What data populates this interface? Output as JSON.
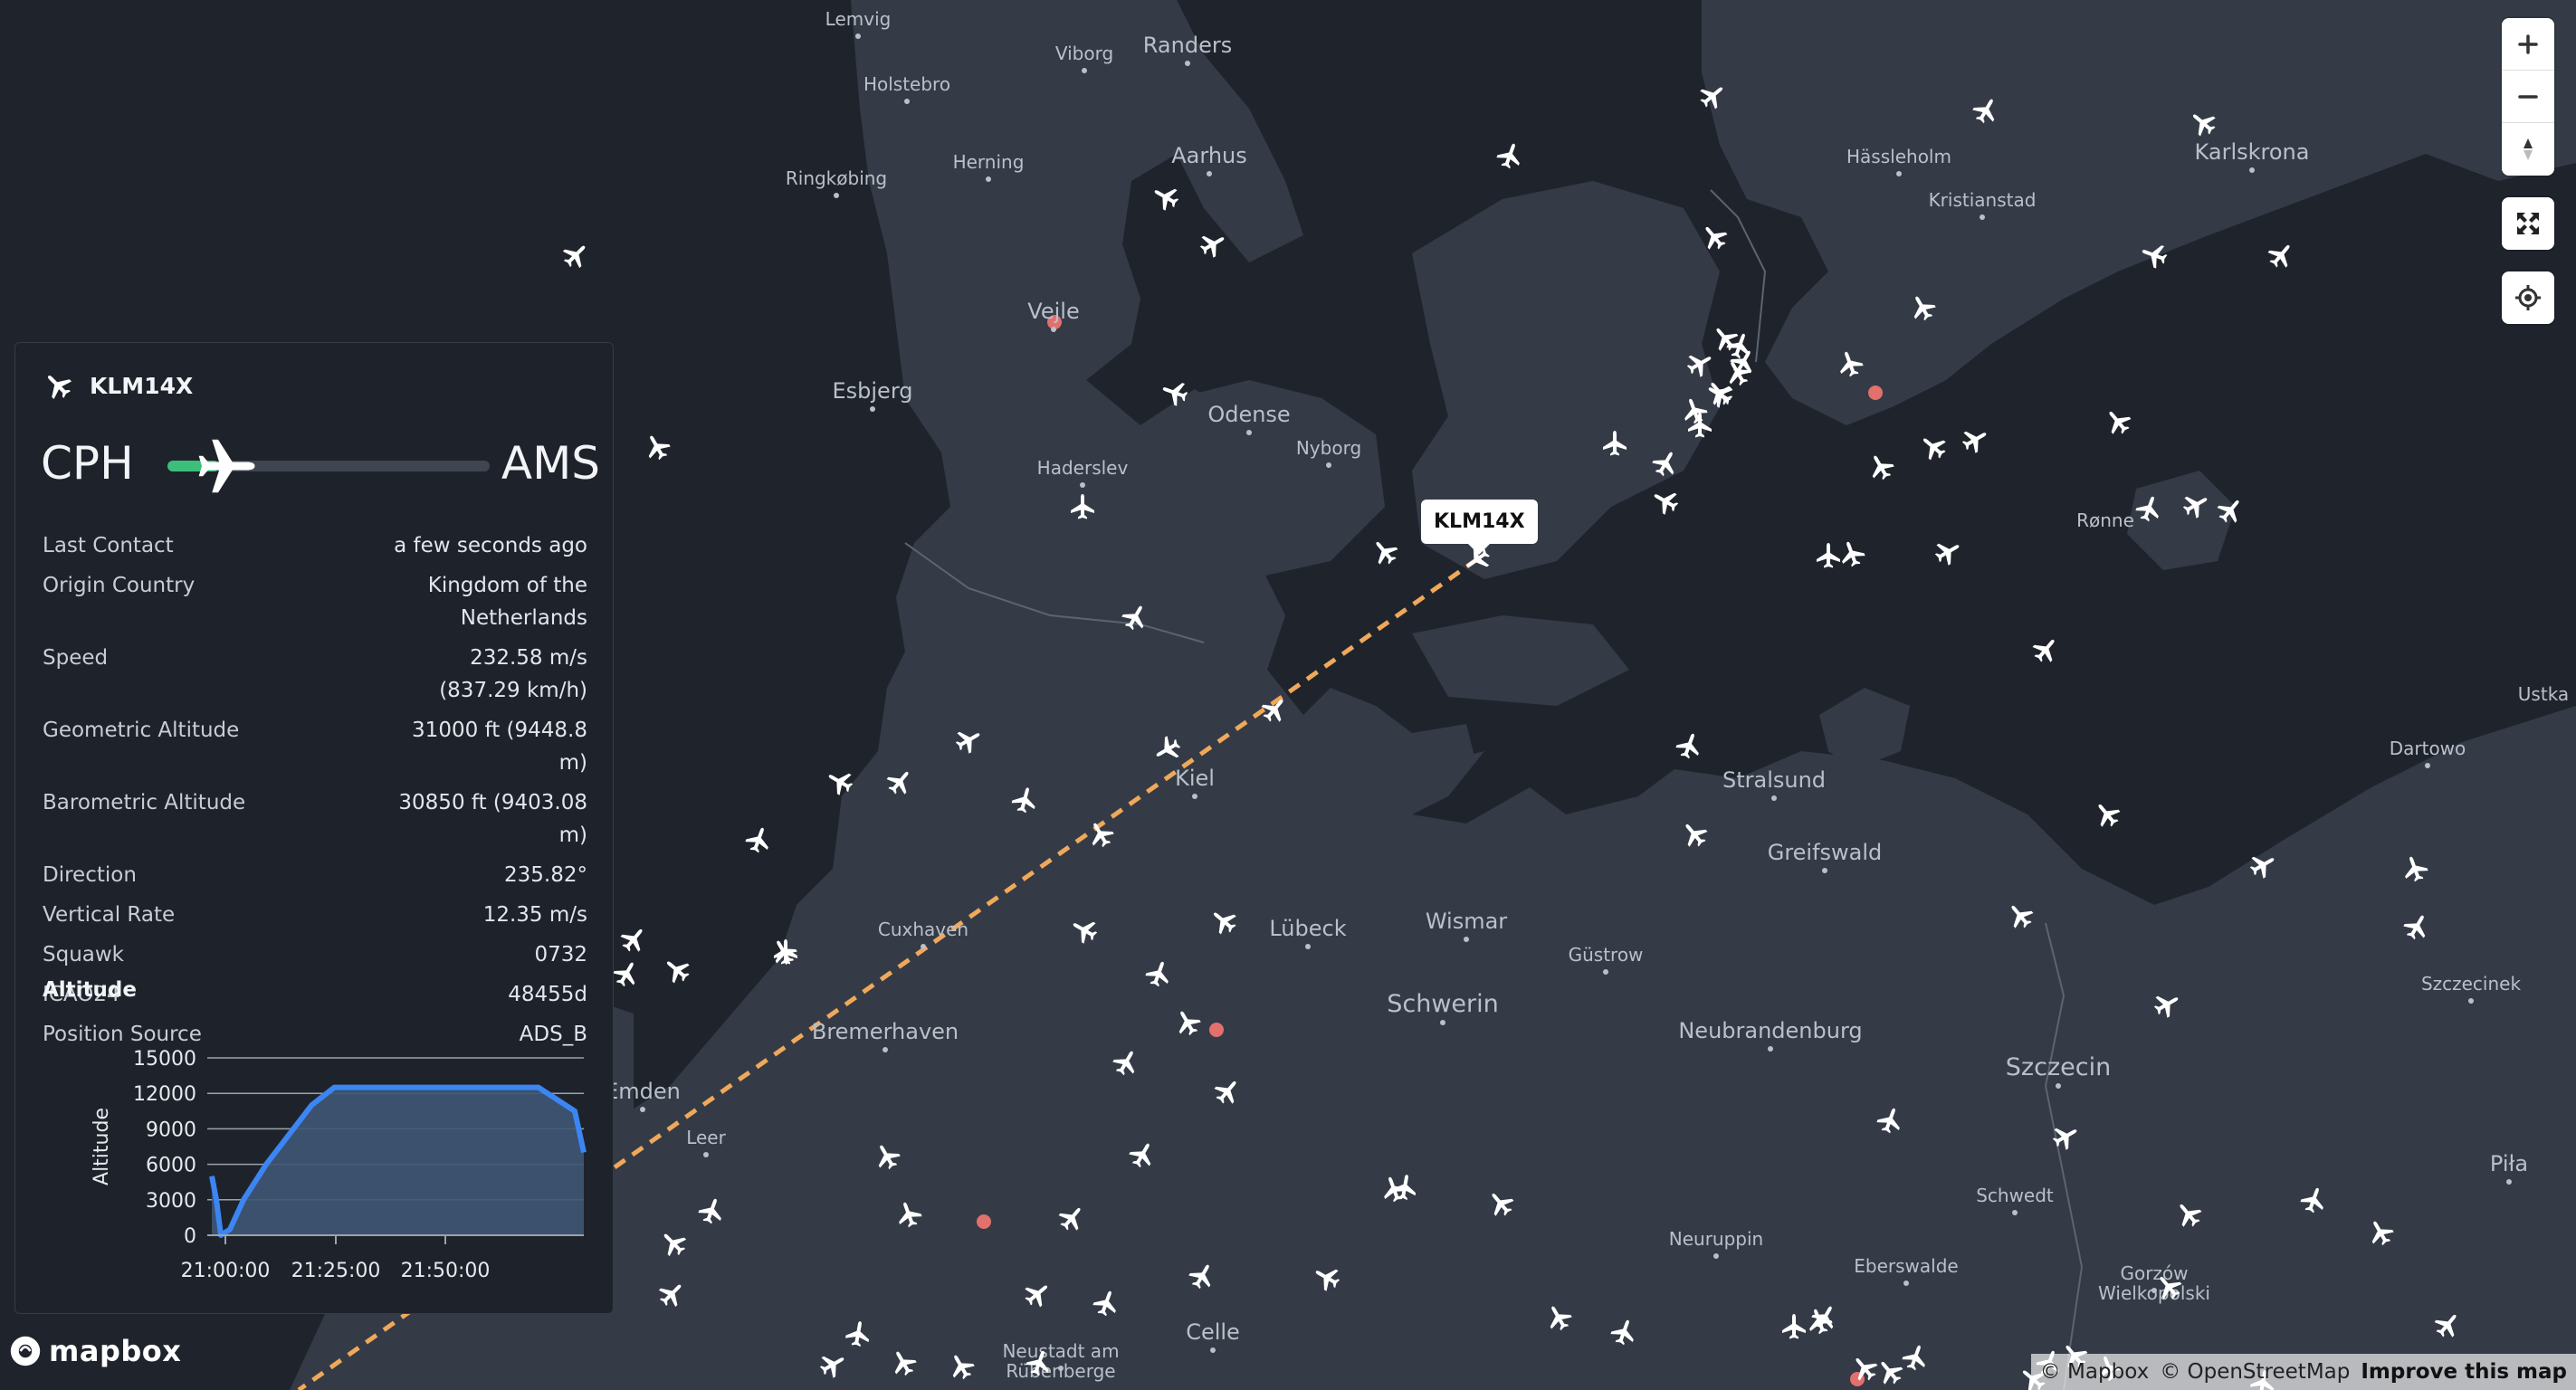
{
  "map": {
    "colors": {
      "land": "#343b46",
      "water": "#1f242c",
      "border": "#5b6470",
      "city_text": "#b9c0c9",
      "flight_path": "#f0a85a",
      "poi": "#e2706c"
    },
    "cities": [
      {
        "name": "Lemvig",
        "size": "s"
      },
      {
        "name": "Viborg",
        "size": "s"
      },
      {
        "name": "Randers",
        "size": "m"
      },
      {
        "name": "Holstebro",
        "size": "s"
      },
      {
        "name": "Herning",
        "size": "s"
      },
      {
        "name": "Aarhus",
        "size": "m"
      },
      {
        "name": "Ringkøbing",
        "size": "s"
      },
      {
        "name": "Vejle",
        "size": "m"
      },
      {
        "name": "Esbjerg",
        "size": "m"
      },
      {
        "name": "Odense",
        "size": "m"
      },
      {
        "name": "Nyborg",
        "size": "s"
      },
      {
        "name": "Haderslev",
        "size": "s"
      },
      {
        "name": "Kiel",
        "size": "m"
      },
      {
        "name": "Cuxhaven",
        "size": "s"
      },
      {
        "name": "Lübeck",
        "size": "m"
      },
      {
        "name": "Wismar",
        "size": "m"
      },
      {
        "name": "Bremerhaven",
        "size": "m"
      },
      {
        "name": "Schwerin",
        "size": "l"
      },
      {
        "name": "Güstrow",
        "size": "s"
      },
      {
        "name": "Emden",
        "size": "m"
      },
      {
        "name": "Leer",
        "size": "s"
      },
      {
        "name": "Stralsund",
        "size": "m"
      },
      {
        "name": "Greifswald",
        "size": "m"
      },
      {
        "name": "Neubrandenburg",
        "size": "m"
      },
      {
        "name": "Szczecin",
        "size": "l"
      },
      {
        "name": "Schwedt",
        "size": "s"
      },
      {
        "name": "Neuruppin",
        "size": "s"
      },
      {
        "name": "Eberswalde",
        "size": "s"
      },
      {
        "name": "Gorzów Wielkopolski",
        "size": "s"
      },
      {
        "name": "Celle",
        "size": "m"
      },
      {
        "name": "Neustadt am Rübenberge",
        "size": "s"
      },
      {
        "name": "Hässleholm",
        "size": "s"
      },
      {
        "name": "Kristianstad",
        "size": "s"
      },
      {
        "name": "Karlskrona",
        "size": "m"
      },
      {
        "name": "Rønne",
        "size": "s"
      },
      {
        "name": "Dartowo",
        "size": "s"
      },
      {
        "name": "Ustka",
        "size": "s"
      },
      {
        "name": "Szczecinek",
        "size": "s"
      },
      {
        "name": "Piła",
        "size": "m"
      }
    ],
    "selected_flight_label": "KLM14X"
  },
  "controls": {
    "zoom_in": "zoom-in",
    "zoom_out": "zoom-out",
    "compass": "compass",
    "fullscreen": "fullscreen",
    "geolocate": "geolocate"
  },
  "panel": {
    "callsign": "KLM14X",
    "origin": "CPH",
    "destination": "AMS",
    "progress": 0.12,
    "fields": [
      {
        "key": "Last Contact",
        "value": "a few seconds ago"
      },
      {
        "key": "Origin Country",
        "value": "Kingdom of the Netherlands"
      },
      {
        "key": "Speed",
        "value": "232.58 m/s (837.29 km/h)"
      },
      {
        "key": "Geometric Altitude",
        "value": "31000 ft (9448.8 m)"
      },
      {
        "key": "Barometric Altitude",
        "value": "30850 ft (9403.08 m)"
      },
      {
        "key": "Direction",
        "value": "235.82°"
      },
      {
        "key": "Vertical Rate",
        "value": "12.35 m/s"
      },
      {
        "key": "Squawk",
        "value": "0732"
      },
      {
        "key": "ICAO24",
        "value": "48455d"
      },
      {
        "key": "Position Source",
        "value": "ADS_B"
      }
    ],
    "altitude_title": "Altitude"
  },
  "chart_data": {
    "type": "area",
    "title": "Altitude",
    "ylabel": "Altitude",
    "xlabel": "",
    "ylim": [
      0,
      15000
    ],
    "yticks": [
      0,
      3000,
      6000,
      9000,
      12000,
      15000
    ],
    "xticks": [
      "21:00:00",
      "21:25:00",
      "21:50:00"
    ],
    "x_minutes_from_2100": [
      -2,
      -1,
      0,
      2,
      5,
      10,
      15,
      20,
      25,
      35,
      45,
      60,
      70,
      78,
      80
    ],
    "values": [
      5000,
      3000,
      0,
      500,
      3000,
      6000,
      8500,
      11000,
      12500,
      12500,
      12500,
      12500,
      12500,
      10500,
      7000
    ],
    "colors": {
      "line": "#3b86f2",
      "fill": "#3e5676",
      "grid": "#9aa3ad"
    }
  },
  "attribution": {
    "copyright_mapbox": "© Mapbox",
    "copyright_osm": "© OpenStreetMap",
    "improve": "Improve this map",
    "logo": "mapbox"
  }
}
